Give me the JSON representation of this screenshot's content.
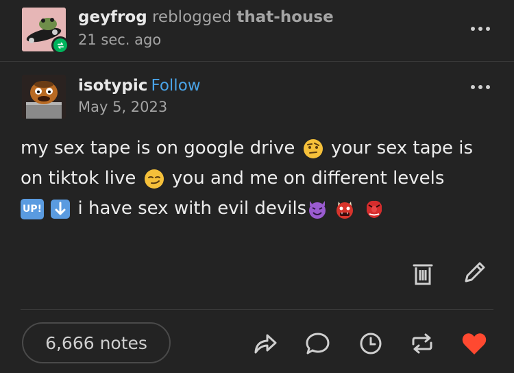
{
  "reblog_header": {
    "reblogger": "geyfrog",
    "action": "reblogged",
    "source": "that-house",
    "time": "21 sec. ago"
  },
  "post_header": {
    "author": "isotypic",
    "follow_label": "Follow",
    "date": "May 5, 2023"
  },
  "post": {
    "line1_a": "my sex tape is on google drive",
    "line1_b": "your sex tape is",
    "line2_a": "on tiktok live",
    "line2_b": "you and me on different levels",
    "line3": "i have sex with evil devils",
    "up_badge": "UP!"
  },
  "footer": {
    "notes": "6,666 notes"
  },
  "colors": {
    "background": "#232323",
    "follow": "#4aa4e8",
    "like": "#ff4930",
    "reblog_badge": "#00b35c"
  },
  "icons": [
    "reblog-badge-icon",
    "more-options-icon",
    "delete-icon",
    "edit-icon",
    "share-icon",
    "reply-icon",
    "history-icon",
    "reblog-icon",
    "like-icon"
  ]
}
